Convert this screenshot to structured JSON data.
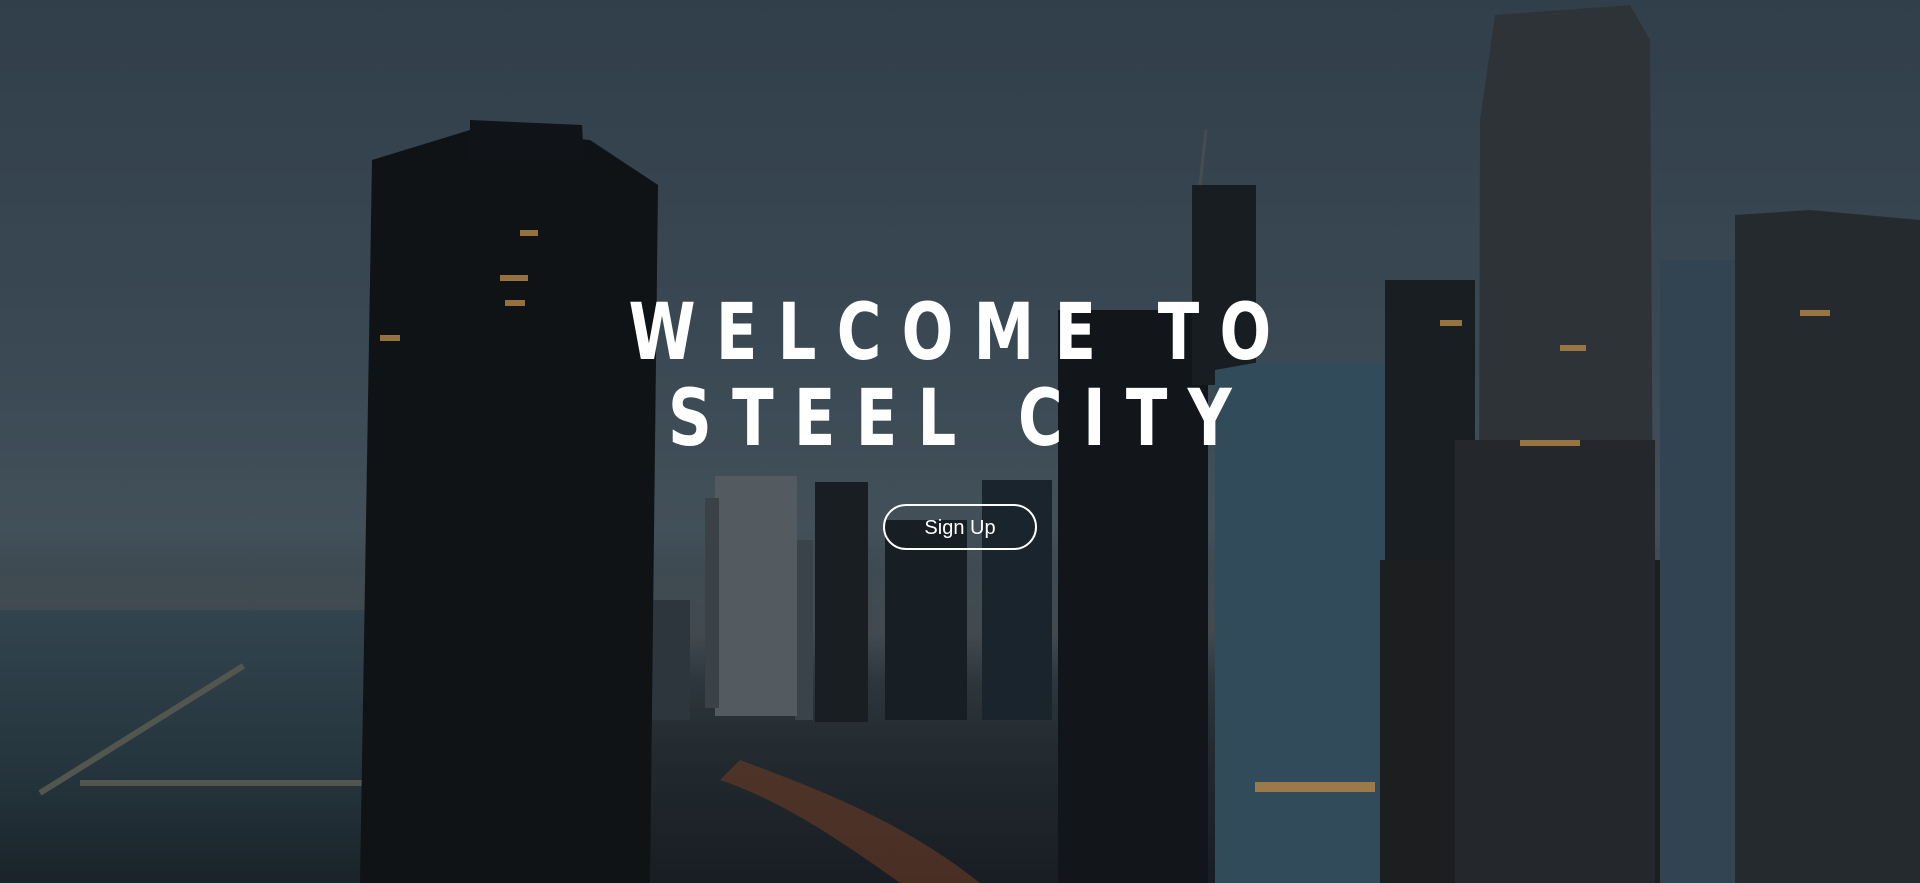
{
  "hero": {
    "title_line1": "WELCOME TO",
    "title_line2": "STEEL CITY",
    "signup_label": "Sign Up",
    "background_image": "city-skyline-at-dusk"
  },
  "colors": {
    "title": "#ffffff",
    "button_border": "#ffffff",
    "overlay": "#0a1016"
  }
}
